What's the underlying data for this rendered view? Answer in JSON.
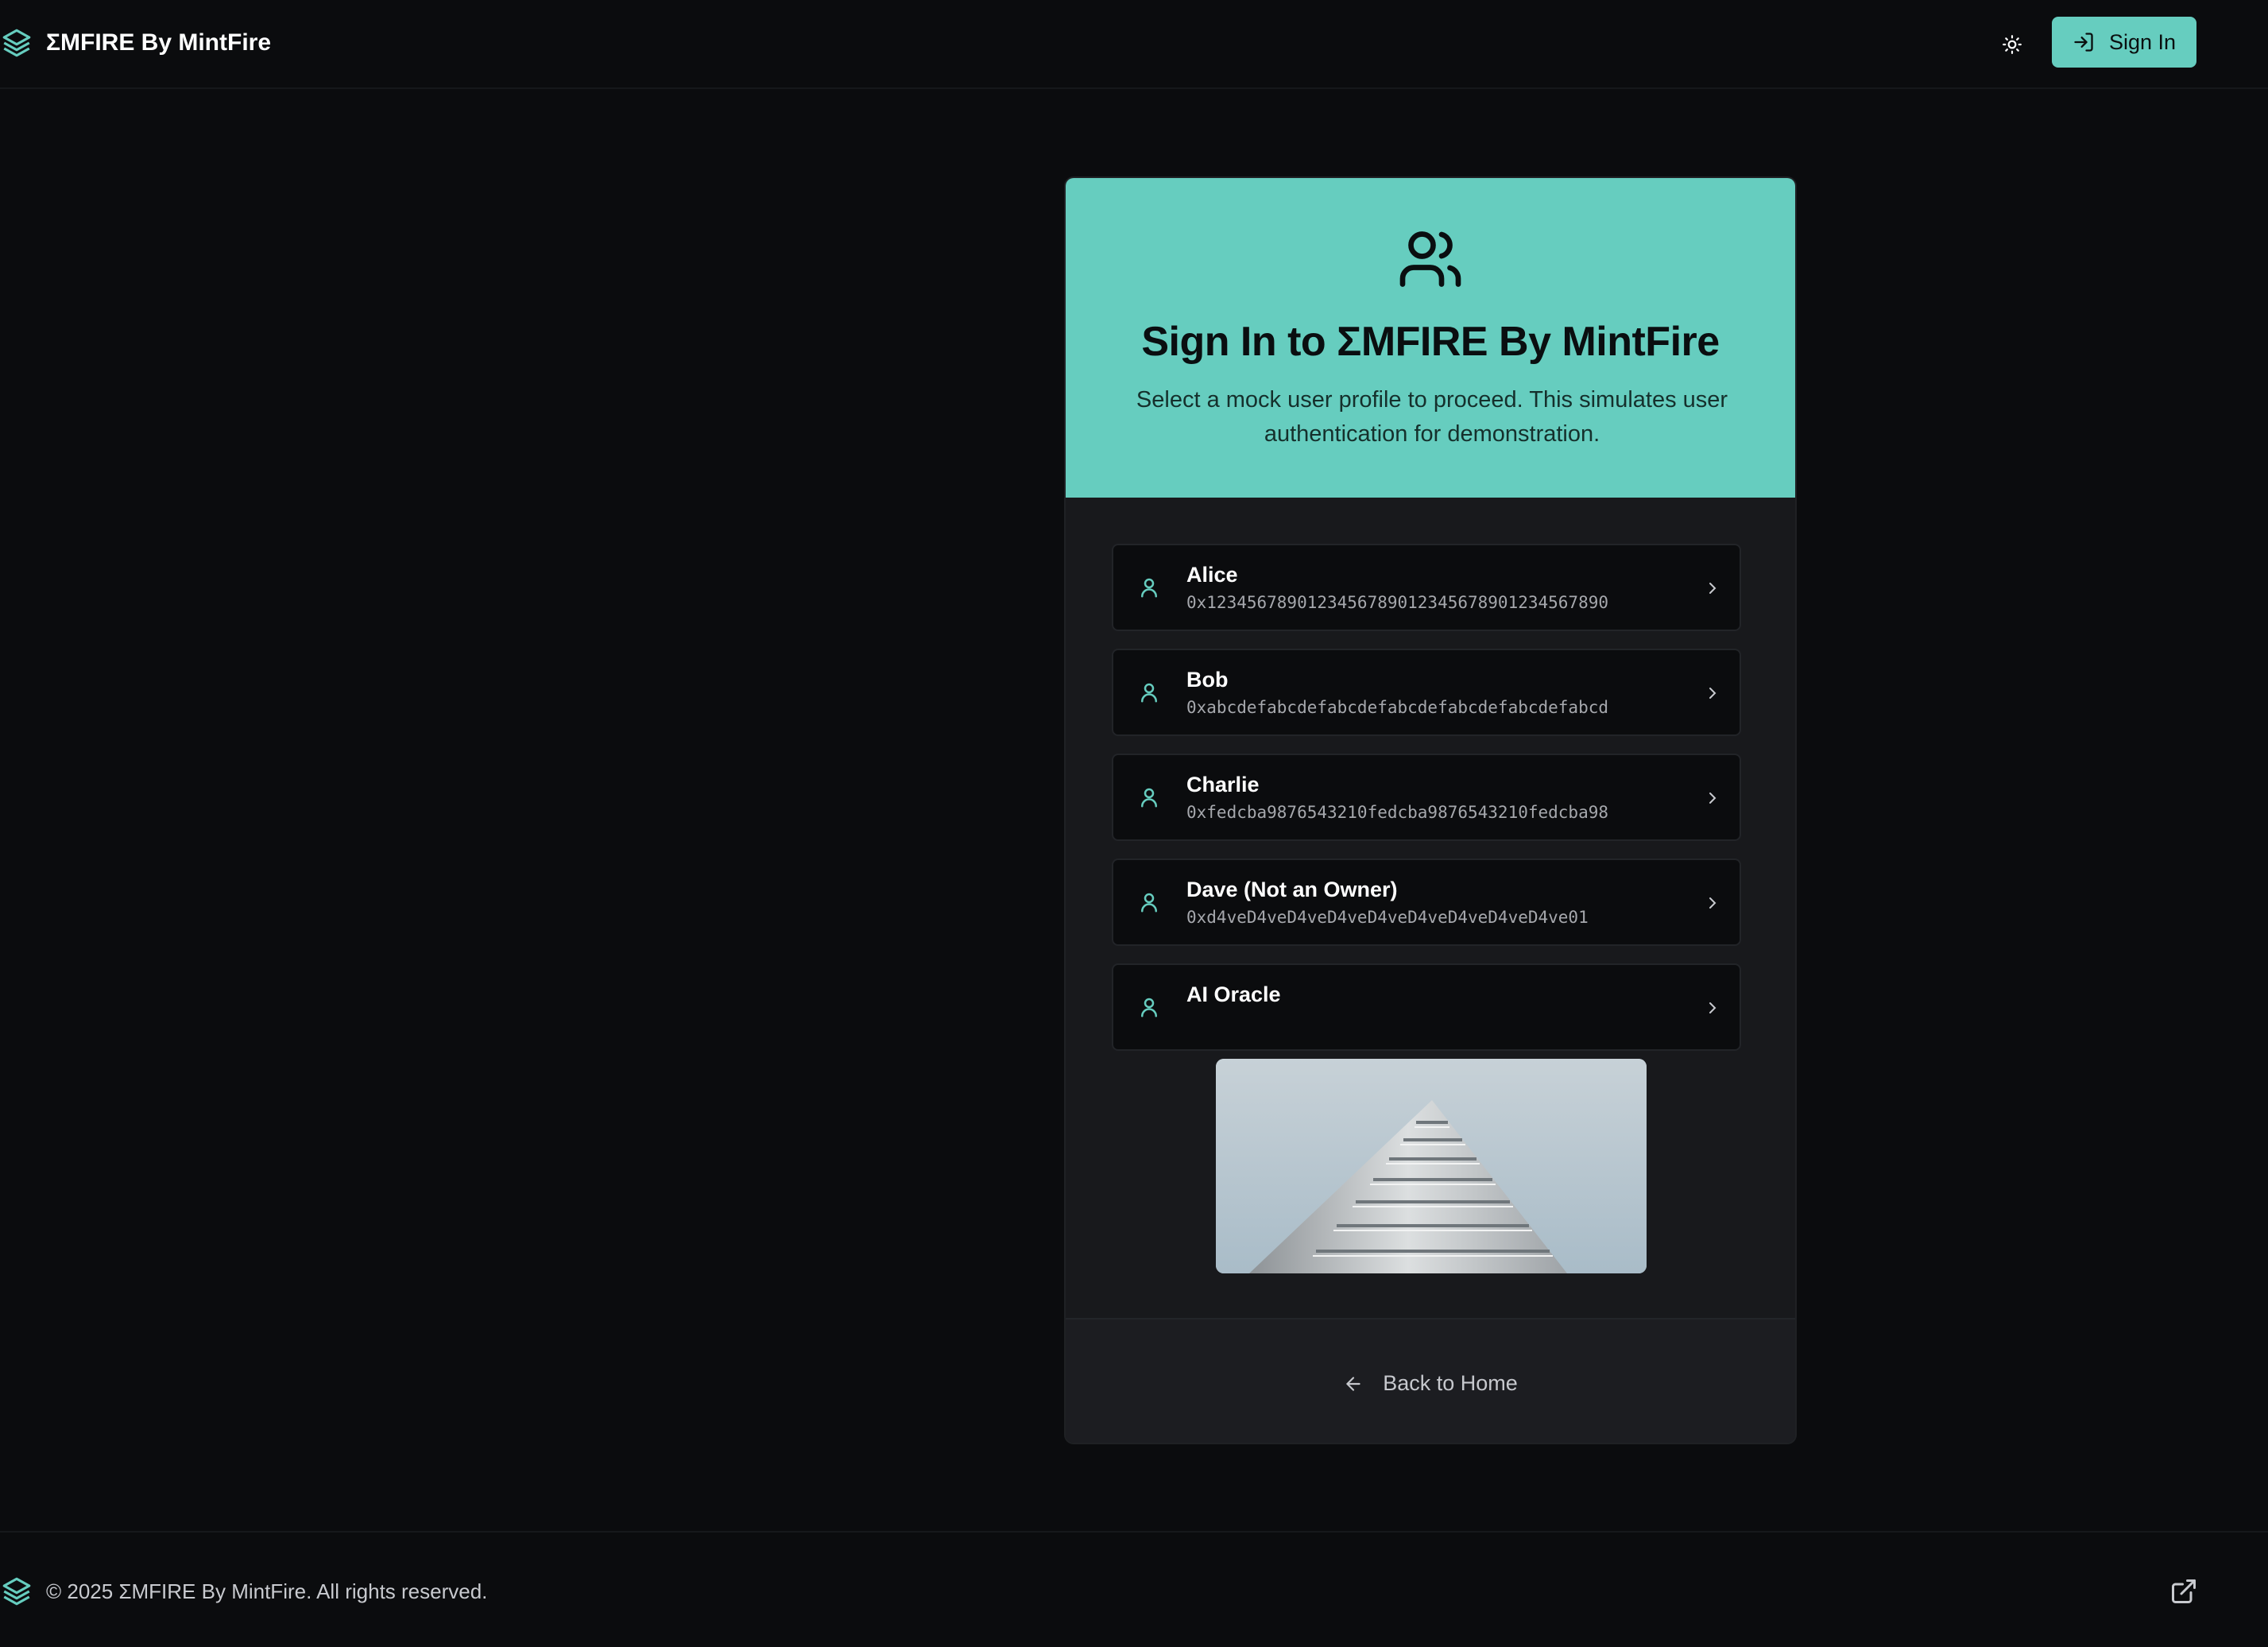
{
  "header": {
    "brand": "ΣMFIRE By MintFire",
    "theme_toggle_icon": "sun-icon",
    "signin_label": "Sign In",
    "signin_icon": "log-in-icon"
  },
  "card": {
    "icon": "users-icon",
    "title": "Sign In to ΣMFIRE By MintFire",
    "subtitle": "Select a mock user profile to proceed. This simulates user authentication for demonstration.",
    "users": [
      {
        "name": "Alice",
        "address": "0x1234567890123456789012345678901234567890"
      },
      {
        "name": "Bob",
        "address": "0xabcdefabcdefabcdefabcdefabcdefabcdefabcd"
      },
      {
        "name": "Charlie",
        "address": "0xfedcba9876543210fedcba9876543210fedcba98"
      },
      {
        "name": "Dave (Not an Owner)",
        "address": "0xd4veD4veD4veD4veD4veD4veD4veD4veD4ve01"
      },
      {
        "name": "AI Oracle",
        "address": ""
      }
    ],
    "back_label": "Back to Home"
  },
  "footer": {
    "copyright": "© 2025 ΣMFIRE By MintFire. All rights reserved.",
    "external_icon": "external-link-icon"
  },
  "colors": {
    "accent": "#66cdbf",
    "background": "#0b0c0e",
    "card": "#18191c"
  }
}
